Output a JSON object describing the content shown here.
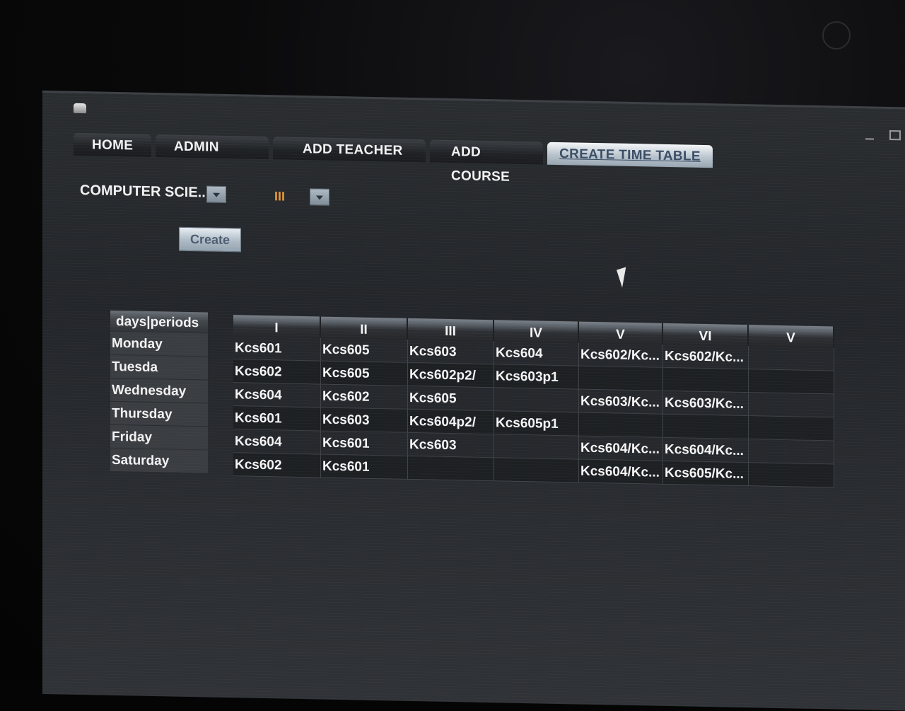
{
  "tabs": [
    {
      "label": "HOME",
      "active": false
    },
    {
      "label": "ADMIN",
      "active": false
    },
    {
      "label": "ADD TEACHER",
      "active": false
    },
    {
      "label": "ADD COURSE",
      "active": false
    },
    {
      "label": "CREATE TIME TABLE",
      "active": true
    }
  ],
  "form": {
    "department": "COMPUTER SCIE...",
    "semester": "III",
    "create_label": "Create"
  },
  "days_table": {
    "header": "days|periods",
    "days": [
      "Monday",
      "Tuesda",
      "Wednesday",
      "Thursday",
      "Friday",
      "Saturday"
    ]
  },
  "timetable": {
    "periods": [
      "I",
      "II",
      "III",
      "IV",
      "V",
      "VI",
      "V"
    ],
    "rows": [
      [
        "Kcs601",
        "Kcs605",
        "Kcs603",
        "Kcs604",
        "Kcs602/Kc...",
        "Kcs602/Kc...",
        ""
      ],
      [
        "Kcs602",
        "Kcs605",
        "Kcs602p2/",
        "Kcs603p1",
        "",
        "",
        ""
      ],
      [
        "Kcs604",
        "Kcs602",
        "Kcs605",
        "",
        "Kcs603/Kc...",
        "Kcs603/Kc...",
        ""
      ],
      [
        "Kcs601",
        "Kcs603",
        "Kcs604p2/",
        "Kcs605p1",
        "",
        "",
        ""
      ],
      [
        "Kcs604",
        "Kcs601",
        "Kcs603",
        "",
        "Kcs604/Kc...",
        "Kcs604/Kc...",
        ""
      ],
      [
        "Kcs602",
        "Kcs601",
        "",
        "",
        "Kcs604/Kc...",
        "Kcs605/Kc...",
        ""
      ]
    ]
  },
  "colors": {
    "semester_text": "#e79a35",
    "active_tab_text": "#3b4d66",
    "window_bg": "#25282c"
  },
  "icons": {
    "app": "app-icon",
    "dropdown": "chevron-down-icon",
    "cursor": "mouse-pointer-icon"
  }
}
